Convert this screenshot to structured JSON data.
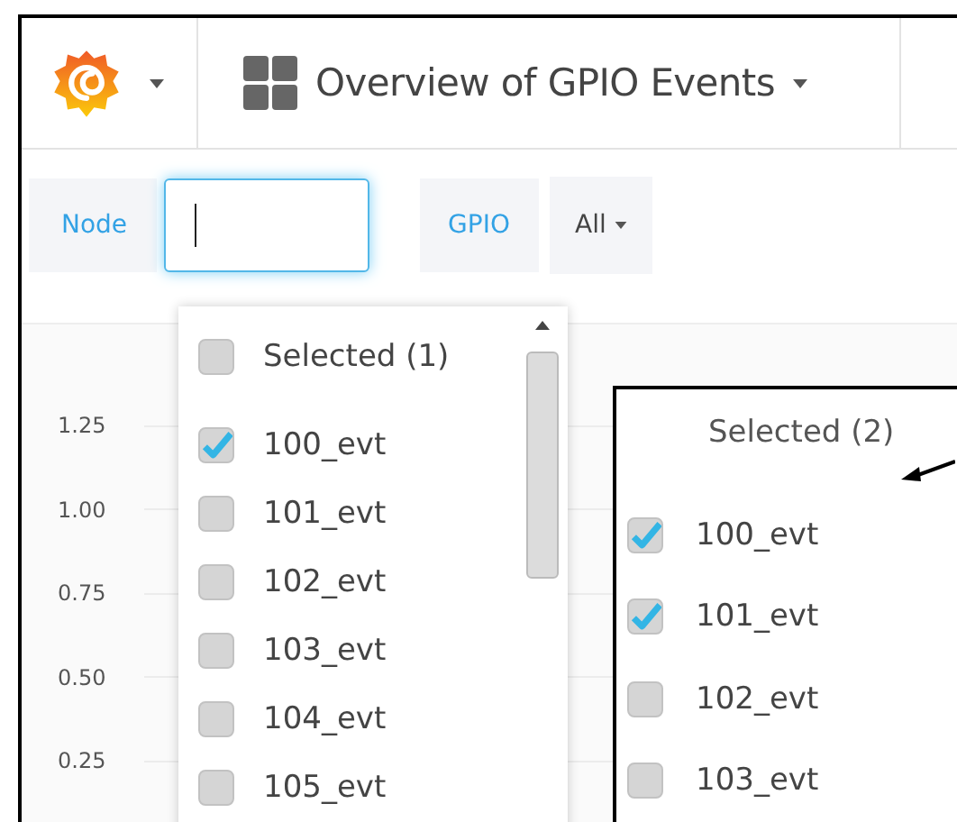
{
  "top_bar": {
    "title": "Overview of GPIO Events"
  },
  "variables": [
    {
      "label": "Node",
      "kind": "text"
    },
    {
      "label": "GPIO",
      "kind": "select",
      "value": "All"
    }
  ],
  "chart": {
    "y_labels": [
      "1.25",
      "1.00",
      "0.75",
      "0.50",
      "0.25"
    ]
  },
  "dropdown": {
    "header": {
      "label": "Selected (1)",
      "checked": false
    },
    "options": [
      {
        "label": "100_evt",
        "checked": true
      },
      {
        "label": "101_evt",
        "checked": false
      },
      {
        "label": "102_evt",
        "checked": false
      },
      {
        "label": "103_evt",
        "checked": false
      },
      {
        "label": "104_evt",
        "checked": false
      },
      {
        "label": "105_evt",
        "checked": false
      }
    ]
  },
  "callout": {
    "header": "Selected (2)",
    "options": [
      {
        "label": "100_evt",
        "checked": true
      },
      {
        "label": "101_evt",
        "checked": true
      },
      {
        "label": "102_evt",
        "checked": false
      },
      {
        "label": "103_evt",
        "checked": false
      }
    ]
  }
}
